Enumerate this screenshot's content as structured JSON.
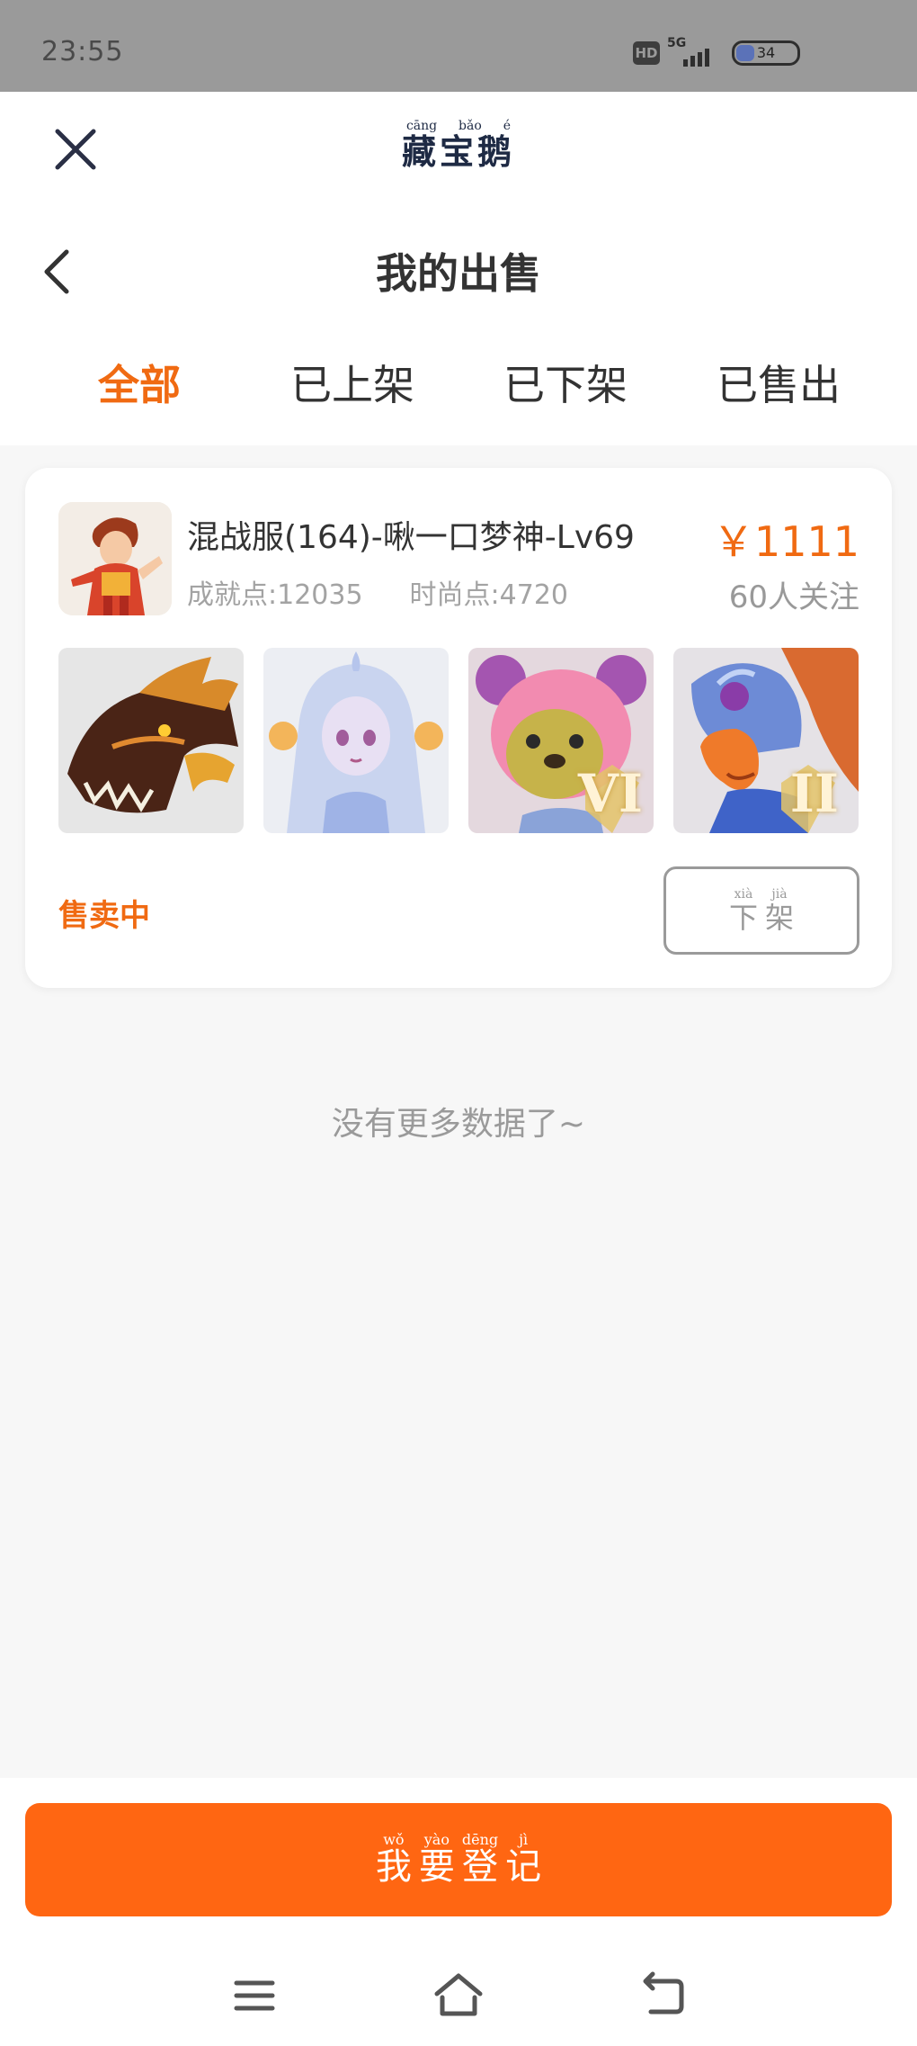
{
  "status_bar": {
    "time": "23:55",
    "hd": "HD",
    "network": "5G",
    "battery": "34"
  },
  "header": {
    "brand_pinyin": [
      "cāng",
      "bǎo",
      "é"
    ],
    "brand_name": "藏宝鹅",
    "page_title": "我的出售"
  },
  "tabs": [
    {
      "label": "全部",
      "active": true
    },
    {
      "label": "已上架",
      "active": false
    },
    {
      "label": "已下架",
      "active": false
    },
    {
      "label": "已售出",
      "active": false
    }
  ],
  "listing": {
    "title": "混战服(164)-啾一口梦神-Lv69",
    "achievement": "成就点:12035",
    "fashion": "时尚点:4720",
    "price": "￥1111",
    "followers": "60人关注",
    "thumbnails": [
      {
        "icon": "dragon-pet-icon"
      },
      {
        "icon": "fairy-pet-icon"
      },
      {
        "icon": "bear-pet-icon",
        "badge": "VI"
      },
      {
        "icon": "eagle-pet-icon",
        "badge": "II"
      }
    ],
    "status": "售卖中",
    "delist_button": {
      "pinyin": [
        "xià",
        "jià"
      ],
      "label": [
        "下",
        "架"
      ]
    }
  },
  "no_more_text": "没有更多数据了~",
  "register_button": {
    "pinyin": [
      "wǒ",
      "yào",
      "dēng",
      "jì"
    ],
    "label": [
      "我",
      "要",
      "登",
      "记"
    ]
  },
  "colors": {
    "accent": "#f06a12",
    "button": "#ff6612",
    "status_bar": "#9a9a9a"
  }
}
